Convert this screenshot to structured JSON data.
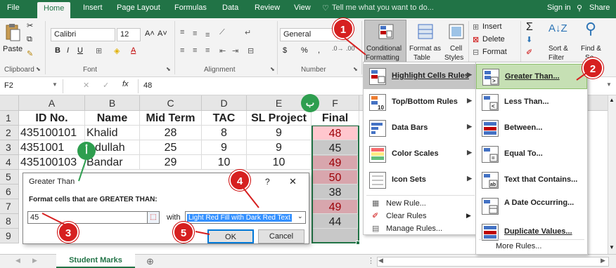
{
  "ribbon_tabs": [
    "File",
    "Home",
    "Insert",
    "Page Layout",
    "Formulas",
    "Data",
    "Review",
    "View"
  ],
  "tell_me": "Tell me what you want to do...",
  "sign_in": "Sign in",
  "share": "Share",
  "clipboard": {
    "paste": "Paste",
    "label": "Clipboard"
  },
  "font": {
    "name": "Calibri",
    "size": "12",
    "label": "Font"
  },
  "alignment": {
    "label": "Alignment"
  },
  "number": {
    "format": "General",
    "currency": "$",
    "percent": "%",
    "comma": ",",
    "label": "Number"
  },
  "styles": {
    "cond_line1": "Conditional",
    "cond_line2": "Formatting",
    "fmt_table_line1": "Format as",
    "fmt_table_line2": "Table",
    "cell_styles_line1": "Cell",
    "cell_styles_line2": "Styles"
  },
  "cells": {
    "insert": "Insert",
    "delete": "Delete",
    "format": "Format"
  },
  "editing": {
    "sort_line1": "Sort &",
    "sort_line2": "Filter",
    "find_line1": "Find &",
    "find_line2": "Se"
  },
  "formula_bar": {
    "name_box": "F2",
    "fx": "fx",
    "value": "48"
  },
  "columns": [
    "A",
    "B",
    "C",
    "D",
    "E",
    "F"
  ],
  "rows": [
    "1",
    "2",
    "3",
    "4",
    "5",
    "6",
    "7",
    "8",
    "9"
  ],
  "table": {
    "headers": [
      "ID No.",
      "Name",
      "Mid Term",
      "TAC",
      "SL Project",
      "Final"
    ],
    "r2": [
      "435100101",
      "Khalid",
      "28",
      "8",
      "9",
      "48"
    ],
    "r3": [
      "4351001",
      "dullah",
      "25",
      "9",
      "9",
      "45"
    ],
    "r4": [
      "435100103",
      "Bandar",
      "29",
      "10",
      "10",
      "49"
    ],
    "f5": "50",
    "f6": "38",
    "f7": "49",
    "f8": "44"
  },
  "cf_menu": {
    "highlight": "Highlight Cells Rules",
    "topbottom": "Top/Bottom Rules",
    "databars": "Data Bars",
    "colorscales": "Color Scales",
    "iconsets": "Icon Sets",
    "newrule": "New Rule...",
    "clearrules": "Clear Rules",
    "managerules": "Manage Rules..."
  },
  "hc_menu": {
    "greater": "Greater Than...",
    "less": "Less Than...",
    "between": "Between...",
    "equal": "Equal To...",
    "textcontains": "Text that Contains...",
    "dateoccur": "A Date Occurring...",
    "duplicate": "Duplicate Values...",
    "more": "More Rules..."
  },
  "dialog": {
    "title": "Greater Than",
    "help": "?",
    "close": "✕",
    "prompt": "Format cells that are GREATER THAN:",
    "value": "45",
    "with": "with",
    "format_option": "Light Red Fill with Dark Red Text",
    "ok": "OK",
    "cancel": "Cancel"
  },
  "badges": {
    "b1": "1",
    "b2": "2",
    "b3": "3",
    "b4": "4",
    "b5": "5",
    "alif": "أ",
    "ba": "ب"
  },
  "sheet_tab": "Student Marks",
  "add_sheet": "⊕",
  "colors": {
    "excel_green": "#217346",
    "highlight_fill": "#ffc7ce",
    "badge_red": "#d62020",
    "badge_green": "#2e9e4f"
  }
}
